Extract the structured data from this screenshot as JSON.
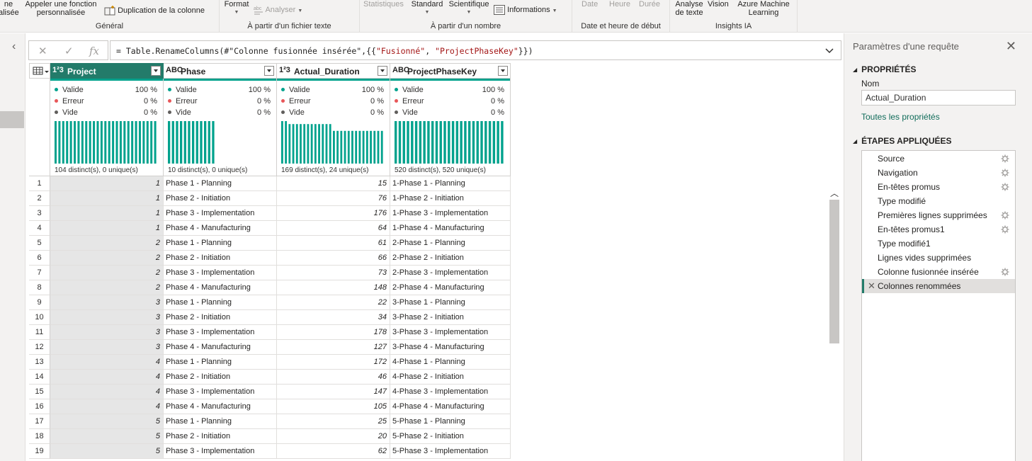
{
  "ribbon": {
    "general": {
      "label": "Général",
      "btn_partial_line1": "ne",
      "btn_partial_line2": "alisée",
      "invoke_line1": "Appeler une fonction",
      "invoke_line2": "personnalisée",
      "duplicate": "Duplication de la colonne"
    },
    "text": {
      "label": "À partir d'un fichier texte",
      "format": "Format",
      "analyze": "Analyser"
    },
    "number": {
      "label": "À partir d'un nombre",
      "statistics": "Statistiques",
      "standard": "Standard",
      "scientific": "Scientifique",
      "information": "Informations"
    },
    "datetime": {
      "label": "Date et heure de début",
      "date": "Date",
      "time": "Heure",
      "duration": "Durée"
    },
    "ai": {
      "label": "Insights IA",
      "text_analysis_line1": "Analyse",
      "text_analysis_line2": "de texte",
      "vision": "Vision",
      "azure_line1": "Azure Machine",
      "azure_line2": "Learning"
    }
  },
  "formula": {
    "prefix": "= Table.RenameColumns(#\"Colonne fusionnée insérée\",{{",
    "arg1": "\"Fusionné\"",
    "sep": ", ",
    "arg2": "\"ProjectPhaseKey\"",
    "suffix": "}})"
  },
  "columns": [
    {
      "name": "Project",
      "type_icon": "1²3",
      "valid_label": "Valide",
      "valid": "100 %",
      "error_label": "Erreur",
      "error": "0 %",
      "empty_label": "Vide",
      "empty": "0 %",
      "distinct": "104 distinct(s), 0 unique(s)"
    },
    {
      "name": "Phase",
      "type_icon": "ABC",
      "valid_label": "Valide",
      "valid": "100 %",
      "error_label": "Erreur",
      "error": "0 %",
      "empty_label": "Vide",
      "empty": "0 %",
      "distinct": "10 distinct(s), 0 unique(s)"
    },
    {
      "name": "Actual_Duration",
      "type_icon": "1²3",
      "valid_label": "Valide",
      "valid": "100 %",
      "error_label": "Erreur",
      "error": "0 %",
      "empty_label": "Vide",
      "empty": "0 %",
      "distinct": "169 distinct(s), 24 unique(s)"
    },
    {
      "name": "ProjectPhaseKey",
      "type_icon": "ABC",
      "valid_label": "Valide",
      "valid": "100 %",
      "error_label": "Erreur",
      "error": "0 %",
      "empty_label": "Vide",
      "empty": "0 %",
      "distinct": "520 distinct(s), 520 unique(s)"
    }
  ],
  "rows": [
    {
      "idx": "1",
      "project": "1",
      "phase": "Phase 1 - Planning",
      "duration": "15",
      "key": "1-Phase 1 - Planning"
    },
    {
      "idx": "2",
      "project": "1",
      "phase": "Phase 2 - Initiation",
      "duration": "76",
      "key": "1-Phase 2 - Initiation"
    },
    {
      "idx": "3",
      "project": "1",
      "phase": "Phase 3 - Implementation",
      "duration": "176",
      "key": "1-Phase 3 - Implementation"
    },
    {
      "idx": "4",
      "project": "1",
      "phase": "Phase 4 - Manufacturing",
      "duration": "64",
      "key": "1-Phase 4 - Manufacturing"
    },
    {
      "idx": "5",
      "project": "2",
      "phase": "Phase 1 - Planning",
      "duration": "61",
      "key": "2-Phase 1 - Planning"
    },
    {
      "idx": "6",
      "project": "2",
      "phase": "Phase 2 - Initiation",
      "duration": "66",
      "key": "2-Phase 2 - Initiation"
    },
    {
      "idx": "7",
      "project": "2",
      "phase": "Phase 3 - Implementation",
      "duration": "73",
      "key": "2-Phase 3 - Implementation"
    },
    {
      "idx": "8",
      "project": "2",
      "phase": "Phase 4 - Manufacturing",
      "duration": "148",
      "key": "2-Phase 4 - Manufacturing"
    },
    {
      "idx": "9",
      "project": "3",
      "phase": "Phase 1 - Planning",
      "duration": "22",
      "key": "3-Phase 1 - Planning"
    },
    {
      "idx": "10",
      "project": "3",
      "phase": "Phase 2 - Initiation",
      "duration": "34",
      "key": "3-Phase 2 - Initiation"
    },
    {
      "idx": "11",
      "project": "3",
      "phase": "Phase 3 - Implementation",
      "duration": "178",
      "key": "3-Phase 3 - Implementation"
    },
    {
      "idx": "12",
      "project": "3",
      "phase": "Phase 4 - Manufacturing",
      "duration": "127",
      "key": "3-Phase 4 - Manufacturing"
    },
    {
      "idx": "13",
      "project": "4",
      "phase": "Phase 1 - Planning",
      "duration": "172",
      "key": "4-Phase 1 - Planning"
    },
    {
      "idx": "14",
      "project": "4",
      "phase": "Phase 2 - Initiation",
      "duration": "46",
      "key": "4-Phase 2 - Initiation"
    },
    {
      "idx": "15",
      "project": "4",
      "phase": "Phase 3 - Implementation",
      "duration": "147",
      "key": "4-Phase 3 - Implementation"
    },
    {
      "idx": "16",
      "project": "4",
      "phase": "Phase 4 - Manufacturing",
      "duration": "105",
      "key": "4-Phase 4 - Manufacturing"
    },
    {
      "idx": "17",
      "project": "5",
      "phase": "Phase 1 - Planning",
      "duration": "25",
      "key": "5-Phase 1 - Planning"
    },
    {
      "idx": "18",
      "project": "5",
      "phase": "Phase 2 - Initiation",
      "duration": "20",
      "key": "5-Phase 2 - Initiation"
    },
    {
      "idx": "19",
      "project": "5",
      "phase": "Phase 3 - Implementation",
      "duration": "62",
      "key": "5-Phase 3 - Implementation"
    }
  ],
  "query_settings": {
    "title": "Paramètres d'une requête",
    "properties_header": "PROPRIÉTÉS",
    "name_label": "Nom",
    "name_value": "Actual_Duration",
    "all_properties": "Toutes les propriétés",
    "steps_header": "ÉTAPES APPLIQUÉES",
    "steps": [
      {
        "label": "Source",
        "gear": true
      },
      {
        "label": "Navigation",
        "gear": true
      },
      {
        "label": "En-têtes promus",
        "gear": true
      },
      {
        "label": "Type modifié",
        "gear": false
      },
      {
        "label": "Premières lignes supprimées",
        "gear": true
      },
      {
        "label": "En-têtes promus1",
        "gear": true
      },
      {
        "label": "Type modifié1",
        "gear": false
      },
      {
        "label": "Lignes vides supprimées",
        "gear": false
      },
      {
        "label": "Colonne fusionnée insérée",
        "gear": true
      },
      {
        "label": "Colonnes renommées",
        "gear": false,
        "active": true
      }
    ]
  },
  "colors": {
    "accent": "#237b6a",
    "quality_bar": "#01a28d",
    "valid_dot": "#01a28d",
    "error_dot": "#e8575a",
    "empty_dot": "#605e5c",
    "link": "#106c5a"
  }
}
